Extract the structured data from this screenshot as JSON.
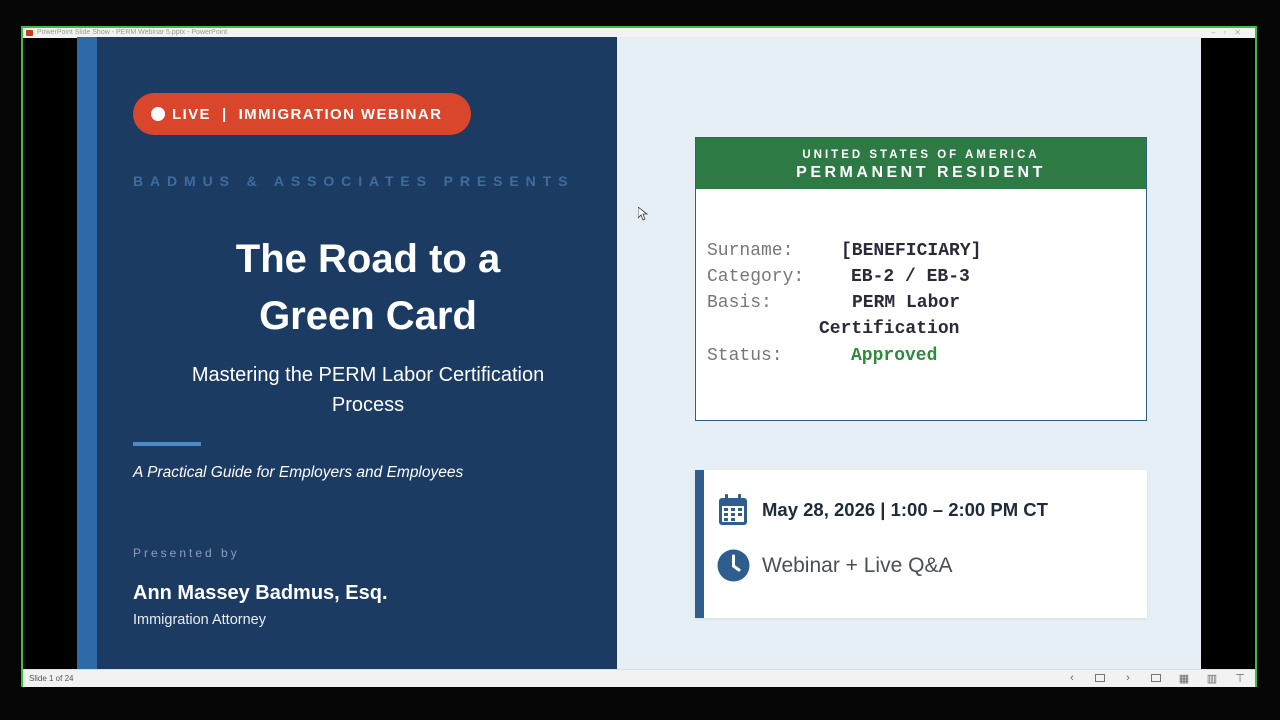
{
  "window": {
    "title": "PowerPoint Slide Show - PERM Webinar 5.pptx - PowerPoint"
  },
  "slide": {
    "live_label": "LIVE",
    "live_separator": "|",
    "webinar_label": "IMMIGRATION WEBINAR",
    "presents": "BADMUS & ASSOCIATES PRESENTS",
    "title_line1": "The Road to a",
    "title_line2": "Green Card",
    "subtitle_line1": "Mastering the PERM Labor Certification",
    "subtitle_line2": "Process",
    "guide": "A Practical Guide for Employers and Employees",
    "presented_by": "Presented by",
    "presenter_name": "Ann Massey Badmus, Esq.",
    "presenter_role": "Immigration Attorney"
  },
  "card": {
    "header_line1": "UNITED STATES OF AMERICA",
    "header_line2": "PERMANENT RESIDENT",
    "surname_label": "Surname:",
    "surname_value": "[BENEFICIARY]",
    "category_label": "Category:",
    "category_value": "EB-2 / EB-3",
    "basis_label": "Basis:",
    "basis_value_line1": "PERM Labor",
    "basis_value_line2": "Certification",
    "status_label": "Status:",
    "status_value": "Approved"
  },
  "event": {
    "date_time": "May 28, 2026  |  1:00 – 2:00 PM CT",
    "format": "Webinar + Live Q&A"
  },
  "statusbar": {
    "slide_counter": "Slide 1 of 24"
  },
  "colors": {
    "navy": "#1b3b62",
    "stripe": "#2f6aa8",
    "live_red": "#d9462b",
    "card_green": "#2d7a45",
    "approved_green": "#2f8a3c",
    "window_border": "#3fbf3f"
  },
  "icons": {
    "calendar": "calendar-icon",
    "clock": "clock-icon"
  }
}
